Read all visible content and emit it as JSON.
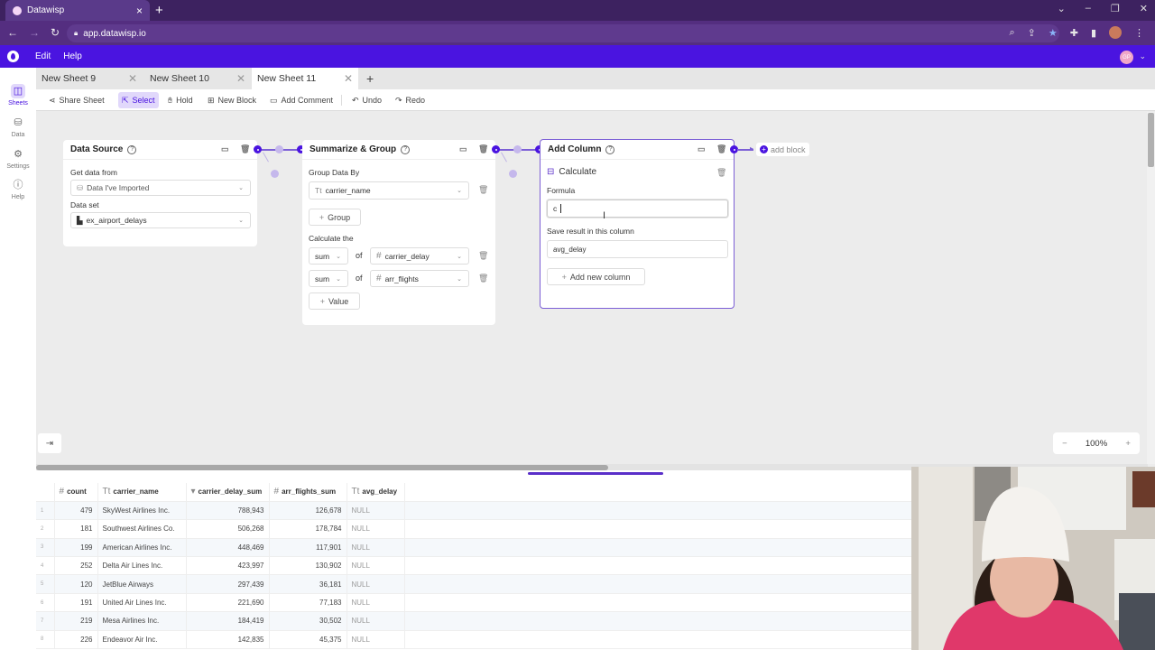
{
  "browser": {
    "tab_title": "Datawisp",
    "url": "app.datawisp.io",
    "new_tab_glyph": "+",
    "window_controls": [
      "chevron-down",
      "minimize",
      "restore",
      "close"
    ],
    "extension_icons": [
      "zoom-icon",
      "share-icon",
      "star-icon",
      "puzzle-icon",
      "sidepanel-icon",
      "profile-avatar",
      "kebab-icon"
    ]
  },
  "app": {
    "menu": [
      "Edit",
      "Help"
    ],
    "user_initials": "GP",
    "accent_color": "#4a14e0"
  },
  "rail": {
    "items": [
      {
        "label": "Sheets",
        "icon": "sheets-icon",
        "active": true
      },
      {
        "label": "Data",
        "icon": "database-icon",
        "active": false
      },
      {
        "label": "Settings",
        "icon": "gear-icon",
        "active": false
      },
      {
        "label": "Help",
        "icon": "help-icon",
        "active": false
      }
    ]
  },
  "sheet_tabs": [
    {
      "label": "New Sheet 9",
      "active": false
    },
    {
      "label": "New Sheet 10",
      "active": false
    },
    {
      "label": "New Sheet 11",
      "active": true
    }
  ],
  "toolbar": {
    "share": "Share Sheet",
    "select": "Select",
    "hold": "Hold",
    "new_block": "New Block",
    "add_comment": "Add Comment",
    "undo": "Undo",
    "redo": "Redo"
  },
  "blocks": {
    "data_source": {
      "title": "Data Source",
      "get_data_label": "Get data from",
      "get_data_value": "Data I've Imported",
      "dataset_label": "Data set",
      "dataset_value": "ex_airport_delays"
    },
    "summarize": {
      "title": "Summarize & Group",
      "group_by_label": "Group Data By",
      "group_by_value": "carrier_name",
      "group_button": "Group",
      "calculate_label": "Calculate the",
      "of_label": "of",
      "aggregations": [
        {
          "func": "sum",
          "column": "carrier_delay"
        },
        {
          "func": "sum",
          "column": "arr_flights"
        }
      ],
      "value_button": "Value"
    },
    "add_column": {
      "title": "Add Column",
      "calc_title": "Calculate",
      "formula_label": "Formula",
      "formula_value": "c",
      "save_label": "Save result in this column",
      "save_value": "avg_delay",
      "add_new_column": "Add new column"
    },
    "add_block": "add block"
  },
  "zoom": {
    "value": "100%",
    "minus": "−",
    "plus": "+"
  },
  "table": {
    "columns": [
      {
        "name": "count",
        "type_icon": "#"
      },
      {
        "name": "carrier_name",
        "type_icon": "Tt"
      },
      {
        "name": "carrier_delay_sum",
        "type_icon": "▾"
      },
      {
        "name": "arr_flights_sum",
        "type_icon": "#"
      },
      {
        "name": "avg_delay",
        "type_icon": "Tt"
      }
    ],
    "rows": [
      [
        "1",
        "479",
        "SkyWest Airlines Inc.",
        "788,943",
        "126,678",
        "NULL"
      ],
      [
        "2",
        "181",
        "Southwest Airlines Co.",
        "506,268",
        "178,784",
        "NULL"
      ],
      [
        "3",
        "199",
        "American Airlines Inc.",
        "448,469",
        "117,901",
        "NULL"
      ],
      [
        "4",
        "252",
        "Delta Air Lines Inc.",
        "423,997",
        "130,902",
        "NULL"
      ],
      [
        "5",
        "120",
        "JetBlue Airways",
        "297,439",
        "36,181",
        "NULL"
      ],
      [
        "6",
        "191",
        "United Air Lines Inc.",
        "221,690",
        "77,183",
        "NULL"
      ],
      [
        "7",
        "219",
        "Mesa Airlines Inc.",
        "184,419",
        "30,502",
        "NULL"
      ],
      [
        "8",
        "226",
        "Endeavor Air Inc.",
        "142,835",
        "45,375",
        "NULL"
      ]
    ]
  }
}
